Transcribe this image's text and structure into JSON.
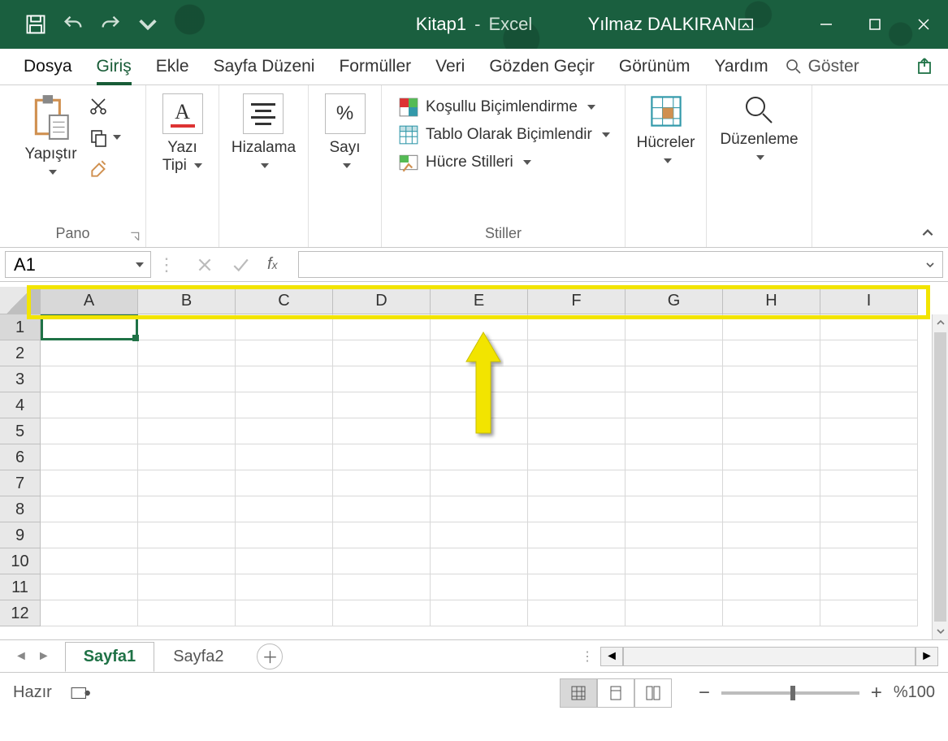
{
  "titlebar": {
    "doc_name": "Kitap1",
    "separator": "-",
    "app_name": "Excel",
    "user_name": "Yılmaz DALKIRAN"
  },
  "tabs": {
    "file": "Dosya",
    "items": [
      "Giriş",
      "Ekle",
      "Sayfa Düzeni",
      "Formüller",
      "Veri",
      "Gözden Geçir",
      "Görünüm",
      "Yardım"
    ],
    "active_index": 0,
    "tell_me": "Göster"
  },
  "ribbon": {
    "clipboard": {
      "paste": "Yapıştır",
      "group": "Pano"
    },
    "font": {
      "label1": "Yazı",
      "label2": "Tipi"
    },
    "alignment": {
      "label": "Hizalama"
    },
    "number": {
      "label": "Sayı"
    },
    "styles": {
      "cond": "Koşullu Biçimlendirme",
      "table": "Tablo Olarak Biçimlendir",
      "cell": "Hücre Stilleri",
      "group": "Stiller"
    },
    "cells": {
      "label": "Hücreler"
    },
    "editing": {
      "label": "Düzenleme"
    }
  },
  "formula_bar": {
    "name_box": "A1",
    "formula": ""
  },
  "grid": {
    "columns": [
      "A",
      "B",
      "C",
      "D",
      "E",
      "F",
      "G",
      "H",
      "I"
    ],
    "rows": [
      1,
      2,
      3,
      4,
      5,
      6,
      7,
      8,
      9,
      10,
      11,
      12
    ],
    "active_cell": "A1"
  },
  "sheets": {
    "tabs": [
      "Sayfa1",
      "Sayfa2"
    ],
    "active_index": 0
  },
  "statusbar": {
    "ready": "Hazır",
    "zoom": "%100"
  }
}
